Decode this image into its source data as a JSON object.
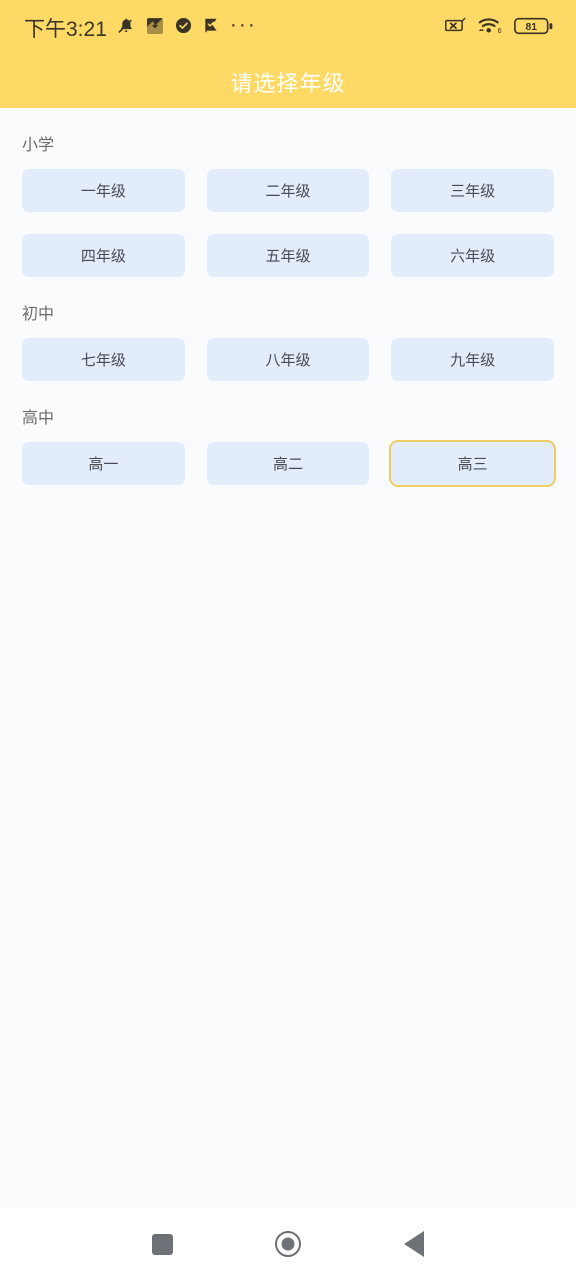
{
  "statusbar": {
    "clock": "下午3:21",
    "left_icons": [
      {
        "name": "bell-mute-icon"
      },
      {
        "name": "app-download-icon"
      },
      {
        "name": "check-circle-icon"
      },
      {
        "name": "flag-check-icon"
      }
    ],
    "overflow": "···",
    "right_icons": [
      {
        "name": "no-sim-icon"
      },
      {
        "name": "wifi-6-icon"
      }
    ],
    "battery_level": "81"
  },
  "header": {
    "title": "请选择年级",
    "background_color": "#ffd965",
    "title_color": "#ffffff"
  },
  "colors": {
    "page_background": "#fafbfc",
    "button_fill": "#e3ecfb",
    "button_text": "#4a4a52",
    "selected_border": "#f0cd62",
    "section_label": "#6b6b6b"
  },
  "sections": [
    {
      "label": "小学",
      "grades": [
        {
          "label": "一年级",
          "selected": false
        },
        {
          "label": "二年级",
          "selected": false
        },
        {
          "label": "三年级",
          "selected": false
        },
        {
          "label": "四年级",
          "selected": false
        },
        {
          "label": "五年级",
          "selected": false
        },
        {
          "label": "六年级",
          "selected": false
        }
      ]
    },
    {
      "label": "初中",
      "grades": [
        {
          "label": "七年级",
          "selected": false
        },
        {
          "label": "八年级",
          "selected": false
        },
        {
          "label": "九年级",
          "selected": false
        }
      ]
    },
    {
      "label": "高中",
      "grades": [
        {
          "label": "高一",
          "selected": false
        },
        {
          "label": "高二",
          "selected": false
        },
        {
          "label": "高三",
          "selected": true
        }
      ]
    }
  ],
  "navbar": {
    "recents_label": "recents",
    "home_label": "home",
    "back_label": "back"
  }
}
